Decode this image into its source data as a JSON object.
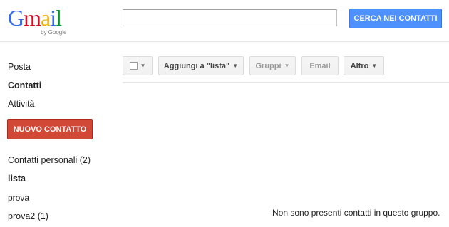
{
  "logo": {
    "letters": [
      "G",
      "m",
      "a",
      "i",
      "l"
    ],
    "letter_colors": [
      "#3369e8",
      "#d50f25",
      "#eeb211",
      "#3369e8",
      "#009925"
    ],
    "byline": "by Google"
  },
  "search": {
    "value": "",
    "placeholder": "",
    "button_label": "CERCA NEI CONTATTI"
  },
  "nav": {
    "mail": "Posta",
    "contacts": "Contatti",
    "tasks": "Attività",
    "new_contact": "NUOVO CONTATTO",
    "groups": [
      "Contatti personali (2)",
      "lista",
      "prova",
      "prova2 (1)"
    ]
  },
  "toolbar": {
    "add_to": "Aggiungi a \"lista\"",
    "groups": "Gruppi",
    "email": "Email",
    "more": "Altro",
    "caret": "▼"
  },
  "main": {
    "empty_message": "Non sono presenti contatti in questo gruppo."
  },
  "colors": {
    "search_button": "#4d90fe",
    "new_contact_button": "#d14836"
  }
}
